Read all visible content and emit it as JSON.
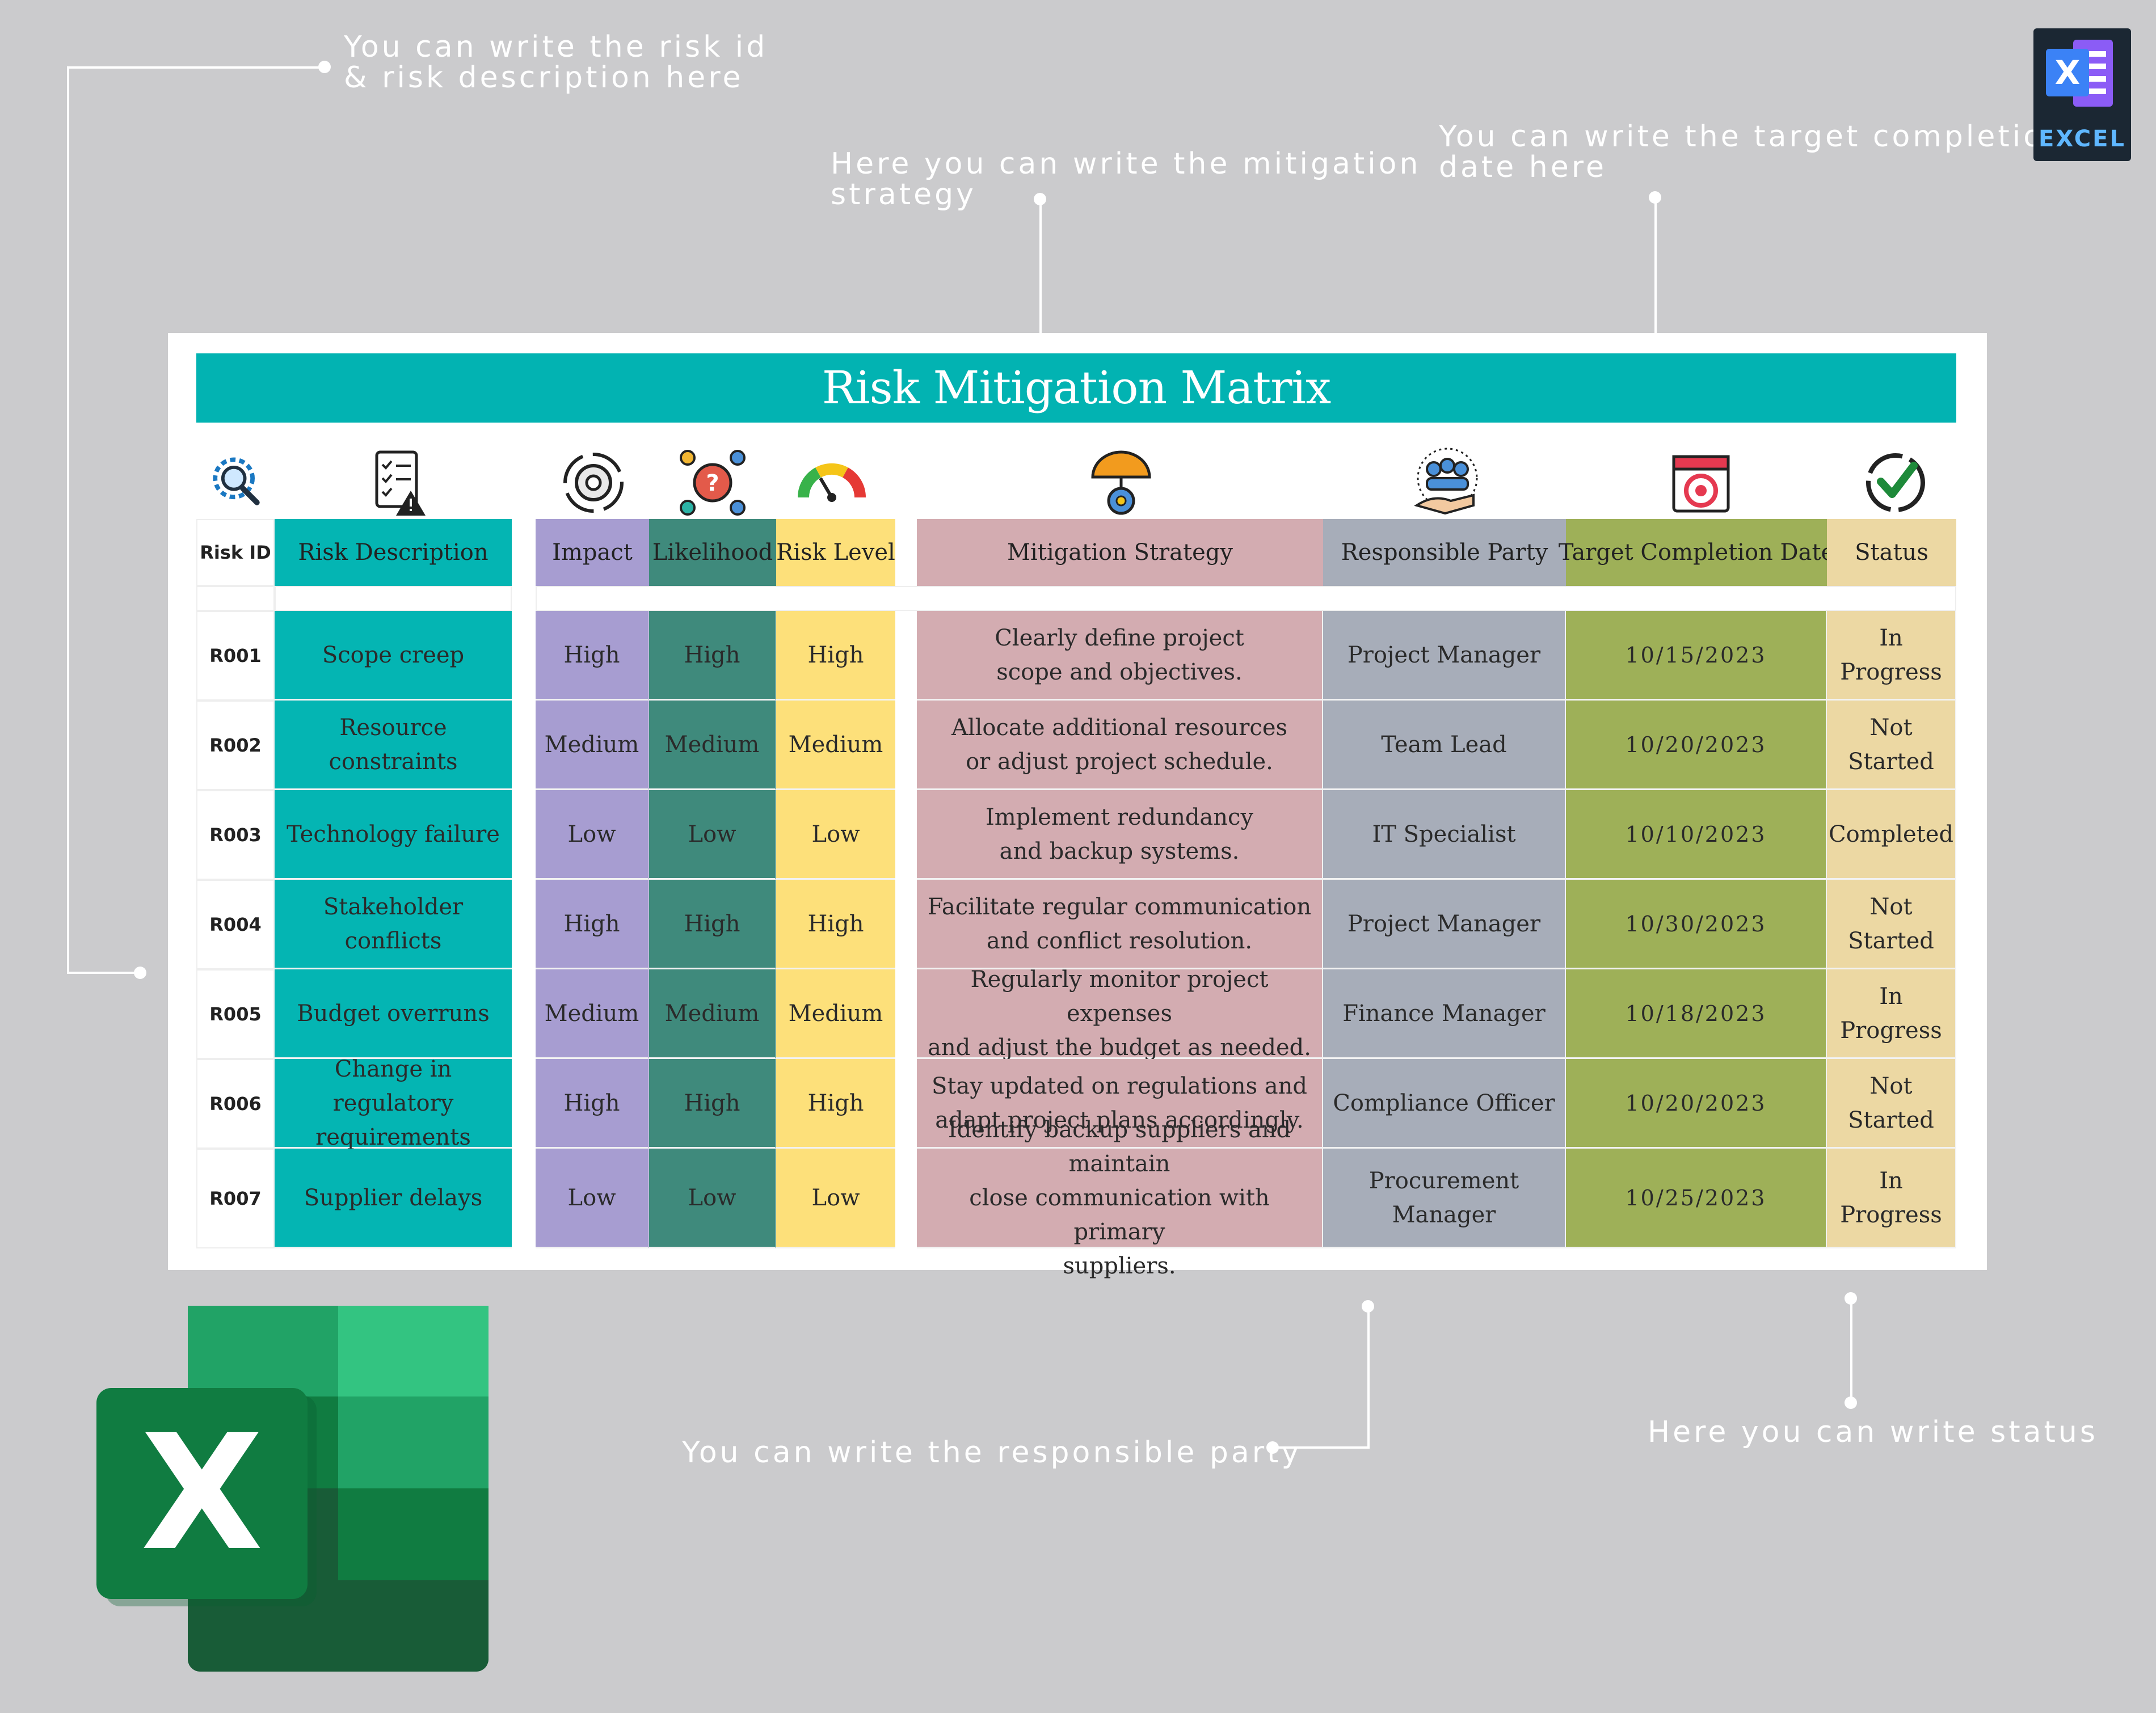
{
  "callouts": {
    "risk_id": "You can write the risk id\n& risk description here",
    "mitigation": "Here you can write the mitigation\nstrategy",
    "target_date": "You can write the target completion\ndate here",
    "responsible": "You can write the responsible party",
    "status": "Here you can write status"
  },
  "badge": {
    "label": "EXCEL",
    "logo_letter": "X"
  },
  "big_logo": {
    "letter": "X"
  },
  "sheet": {
    "title": "Risk Mitigation Matrix",
    "headers": {
      "risk_id": "Risk ID",
      "description": "Risk Description",
      "impact": "Impact",
      "likelihood": "Likelihood",
      "risk_level": "Risk Level",
      "mitigation": "Mitigation Strategy",
      "responsible": "Responsible Party",
      "target_date": "Target Completion Date",
      "status": "Status"
    },
    "rows": [
      {
        "id": "R001",
        "description": "Scope creep",
        "impact": "High",
        "likelihood": "High",
        "level": "High",
        "mitigation": "Clearly define project\nscope and objectives.",
        "responsible": "Project Manager",
        "date": "10/15/2023",
        "status": "In Progress"
      },
      {
        "id": "R002",
        "description": "Resource constraints",
        "impact": "Medium",
        "likelihood": "Medium",
        "level": "Medium",
        "mitigation": "Allocate additional resources\nor adjust project schedule.",
        "responsible": "Team Lead",
        "date": "10/20/2023",
        "status": "Not Started"
      },
      {
        "id": "R003",
        "description": "Technology failure",
        "impact": "Low",
        "likelihood": "Low",
        "level": "Low",
        "mitigation": "Implement redundancy\nand backup systems.",
        "responsible": "IT Specialist",
        "date": "10/10/2023",
        "status": "Completed"
      },
      {
        "id": "R004",
        "description": "Stakeholder conflicts",
        "impact": "High",
        "likelihood": "High",
        "level": "High",
        "mitigation": "Facilitate regular communication\nand conflict resolution.",
        "responsible": "Project Manager",
        "date": "10/30/2023",
        "status": "Not Started"
      },
      {
        "id": "R005",
        "description": "Budget overruns",
        "impact": "Medium",
        "likelihood": "Medium",
        "level": "Medium",
        "mitigation": "Regularly monitor project expenses\nand adjust the budget as needed.",
        "responsible": "Finance Manager",
        "date": "10/18/2023",
        "status": "In Progress"
      },
      {
        "id": "R006",
        "description": "Change in regulatory\nrequirements",
        "impact": "High",
        "likelihood": "High",
        "level": "High",
        "mitigation": "Stay updated on regulations and\nadapt project plans accordingly.",
        "responsible": "Compliance Officer",
        "date": "10/20/2023",
        "status": "Not Started"
      },
      {
        "id": "R007",
        "description": "Supplier delays",
        "impact": "Low",
        "likelihood": "Low",
        "level": "Low",
        "mitigation": "Identify backup suppliers and maintain\nclose communication with primary\nsuppliers.",
        "responsible": "Procurement Manager",
        "date": "10/25/2023",
        "status": "In Progress"
      }
    ]
  },
  "colors": {
    "page_bg": "#cbcbcd",
    "title_bg": "#02b3b2",
    "description": "#04b5b3",
    "impact": "#a79dd1",
    "likelihood": "#3f8a7c",
    "risk_level": "#fde07a",
    "mitigation": "#d3acb1",
    "responsible": "#a7adb9",
    "target_date": "#9eb058",
    "status": "#ecd8a3"
  },
  "icons": [
    "search-gear-icon",
    "checklist-warning-icon",
    "gear-cycle-icon",
    "gear-network-icon",
    "gauge-meter-icon",
    "umbrella-gear-icon",
    "team-hand-icon",
    "calendar-target-icon",
    "check-circle-icon"
  ]
}
